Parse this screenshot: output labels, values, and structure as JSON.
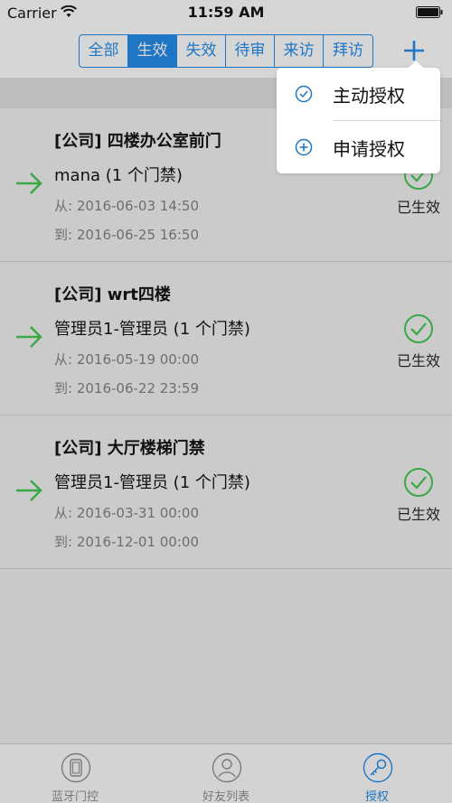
{
  "status_bar": {
    "carrier": "Carrier",
    "time": "11:59 AM"
  },
  "filter_tabs": [
    {
      "label": "全部",
      "active": false
    },
    {
      "label": "生效",
      "active": true
    },
    {
      "label": "失效",
      "active": false
    },
    {
      "label": "待审",
      "active": false
    },
    {
      "label": "来访",
      "active": false
    },
    {
      "label": "拜访",
      "active": false
    }
  ],
  "popover_menu": [
    {
      "label": "主动授权",
      "icon": "check-circle-icon"
    },
    {
      "label": "申请授权",
      "icon": "plus-circle-icon"
    }
  ],
  "authorizations": [
    {
      "title": "[公司] 四楼办公室前门",
      "user": "mana (1 个门禁)",
      "from": "从: 2016-06-03 14:50",
      "to": "到: 2016-06-25 16:50",
      "status": "已生效"
    },
    {
      "title": "[公司] wrt四楼",
      "user": "管理员1-管理员 (1 个门禁)",
      "from": "从: 2016-05-19 00:00",
      "to": "到: 2016-06-22 23:59",
      "status": "已生效"
    },
    {
      "title": "[公司] 大厅楼梯门禁",
      "user": "管理员1-管理员 (1 个门禁)",
      "from": "从: 2016-03-31 00:00",
      "to": "到: 2016-12-01 00:00",
      "status": "已生效"
    }
  ],
  "tab_bar": [
    {
      "label": "蓝牙门控",
      "icon": "phone-door-icon",
      "active": false
    },
    {
      "label": "好友列表",
      "icon": "person-icon",
      "active": false
    },
    {
      "label": "授权",
      "icon": "key-icon",
      "active": true
    }
  ],
  "colors": {
    "accent": "#1f76c4",
    "success": "#3aa845",
    "dim_overlay": "#c9c9c9"
  }
}
